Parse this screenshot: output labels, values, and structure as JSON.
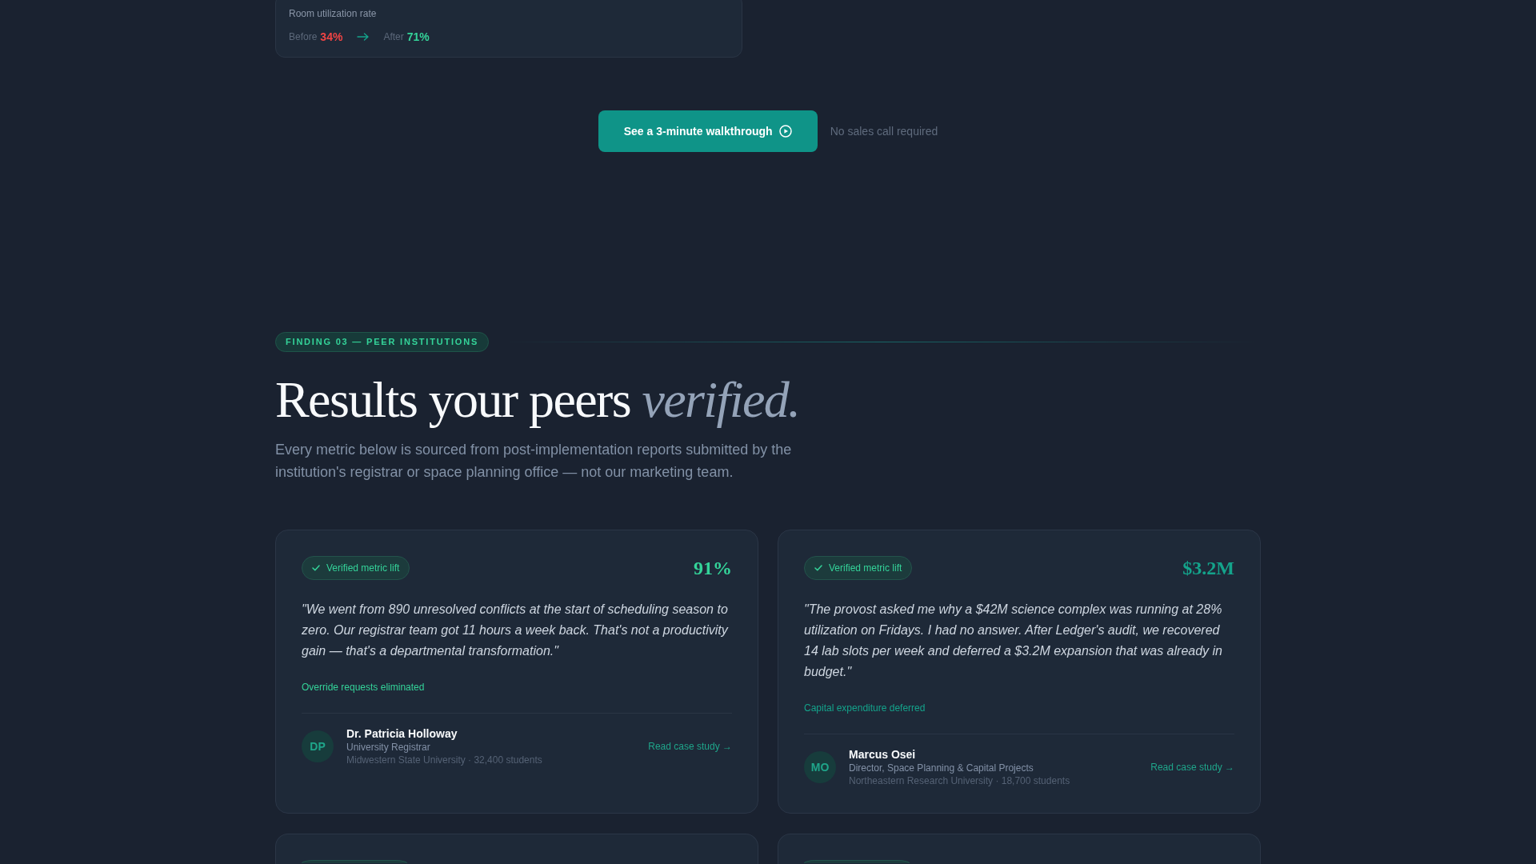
{
  "utilization_card": {
    "label": "Room utilization rate",
    "before_label": "Before",
    "before_value": "34%",
    "after_label": "After",
    "after_value": "71%"
  },
  "cta": {
    "button": "See a 3-minute walkthrough",
    "note": "No sales call required"
  },
  "section": {
    "eyebrow": "FINDING 03 — PEER INSTITUTIONS",
    "title": "Results your peers *verified.*",
    "subtitle": "Every metric below is sourced from post-implementation reports submitted by the institution's registrar or space planning office — not our marketing team."
  },
  "testimonials": [
    {
      "badge": "Verified metric lift",
      "metric": "91%",
      "color": "#34d399",
      "quote": "\"We went from 890 unresolved conflicts at the start of scheduling season to zero. Our registrar team got 11 hours a week back. That's not a productivity gain — that's a departmental transformation.\"",
      "metric_label": "Override requests eliminated",
      "initials": "DP",
      "name": "Dr. Patricia Holloway",
      "role": "University Registrar",
      "institution": "Midwestern State University · 32,400 students",
      "link": "Read case study →"
    },
    {
      "badge": "Verified metric lift",
      "metric": "$3.2M",
      "color": "#14a38b",
      "quote": "\"The provost asked me why a $42M science complex was running at 28% utilization on Fridays. I had no answer. After Ledger's audit, we recovered 14 lab slots per week and deferred a $3.2M expansion that was already in budget.\"",
      "metric_label": "Capital expenditure deferred",
      "initials": "MO",
      "name": "Marcus Osei",
      "role": "Director, Space Planning & Capital Projects",
      "institution": "Northeastern Research University · 18,700 students",
      "link": "Read case study →"
    }
  ],
  "partial_cards": [
    {
      "badge": true
    },
    {
      "badge": true
    }
  ]
}
